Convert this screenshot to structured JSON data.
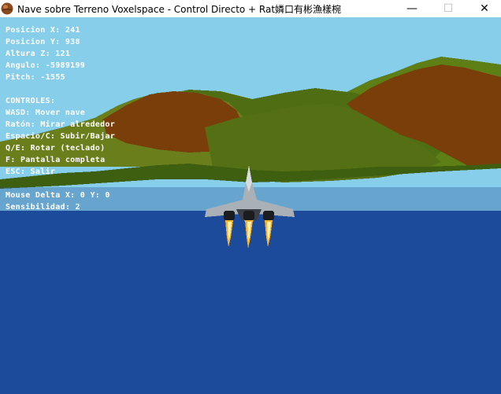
{
  "window": {
    "title": "Nave sobre Terreno Voxelspace - Control Directo + Rat嫾口有彬漁樣椀",
    "controls": {
      "minimize": "—",
      "maximize": "☐",
      "close": "✕"
    }
  },
  "hud": {
    "pos_x": "Posicion X: 241",
    "pos_y": "Posicion Y: 938",
    "altura": "Altura Z: 121",
    "angulo": "Angulo: -5989199",
    "pitch": "Pitch: -1555",
    "controles_header": "CONTROLES:",
    "wasd": "WASD: Mover nave",
    "raton": "Ratón: Mirar alrededor",
    "espacio": "Espacio/C: Subir/Bajar",
    "qe": "Q/E: Rotar (teclado)",
    "f": "F: Pantalla completa",
    "esc": "ESC: Salir",
    "mouse_delta": "Mouse Delta X: 0 Y: 0",
    "sensibilidad": "Sensibilidad: 2"
  },
  "colors": {
    "sky": "#87ceeb",
    "water": "#1b4b9a",
    "hill_green": "#5e7f16",
    "hill_brown": "#7a3e0a"
  }
}
